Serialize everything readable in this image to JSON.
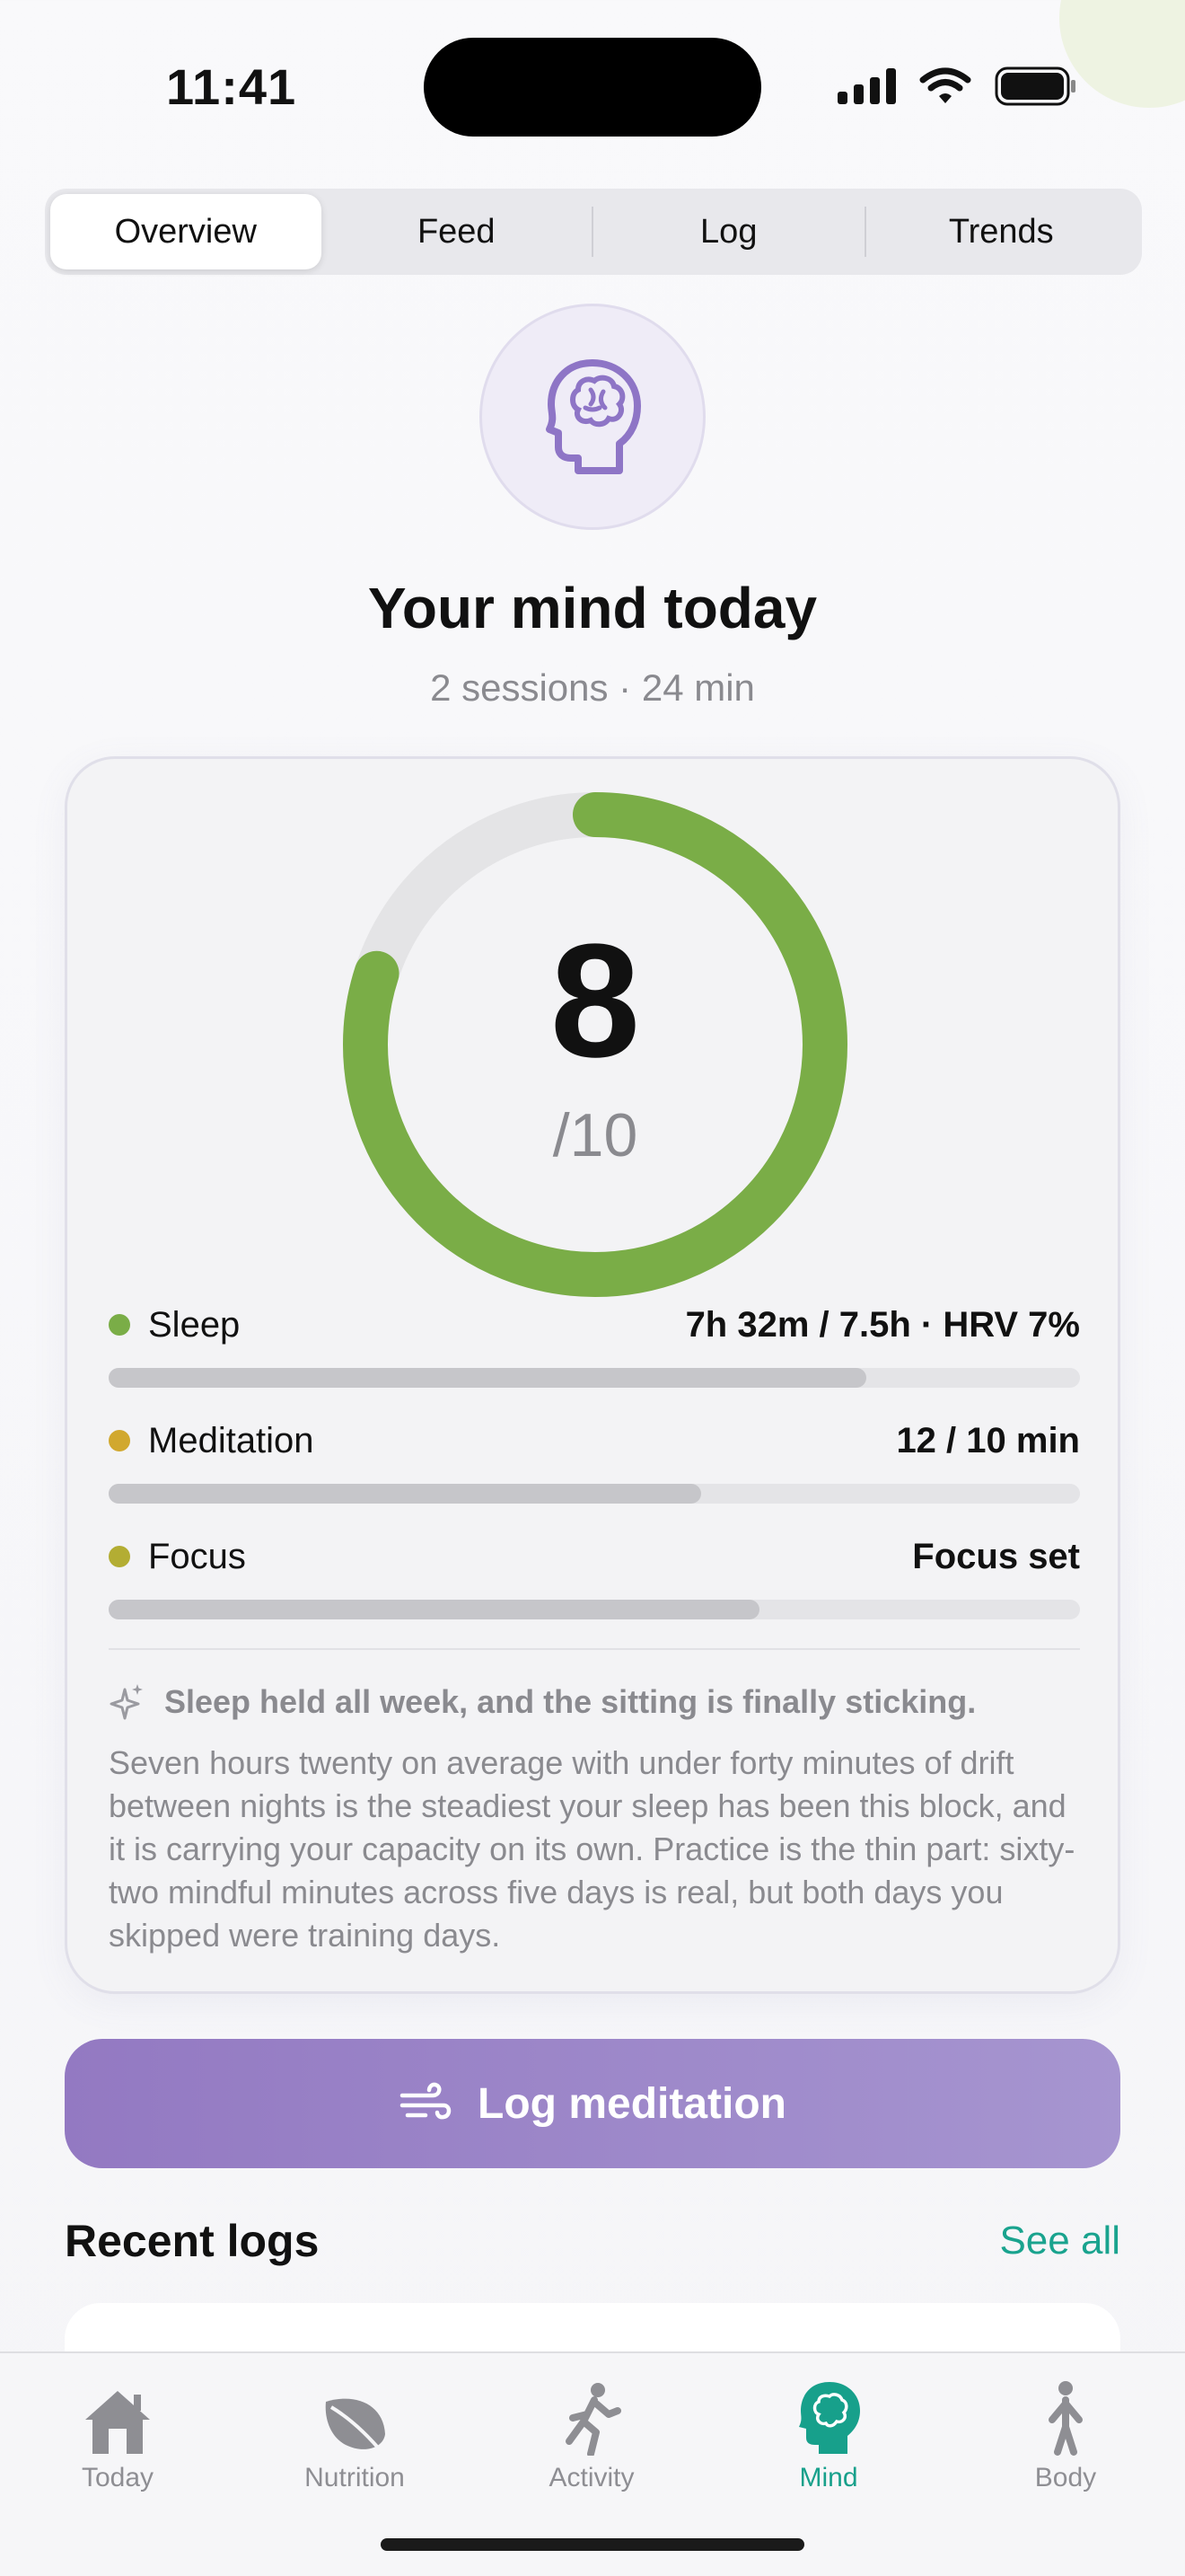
{
  "status_bar": {
    "time": "11:41"
  },
  "segmented": {
    "tabs": [
      {
        "label": "Overview",
        "active": true
      },
      {
        "label": "Feed",
        "active": false
      },
      {
        "label": "Log",
        "active": false
      },
      {
        "label": "Trends",
        "active": false
      }
    ]
  },
  "header": {
    "icon": "brain-head-icon",
    "title": "Your mind today",
    "subtitle": "2 sessions · 24 min"
  },
  "score": {
    "value": "8",
    "denominator": "/10",
    "fraction": 0.8,
    "ring_color": "#7aad47",
    "track_color": "#e4e4e6"
  },
  "metrics": [
    {
      "name": "Sleep",
      "value": "7h 32m / 7.5h · HRV 7%",
      "dot_color": "#7aad47",
      "progress": 0.78
    },
    {
      "name": "Meditation",
      "value": "12 / 10 min",
      "dot_color": "#d1a82e",
      "progress": 0.61
    },
    {
      "name": "Focus",
      "value": "Focus set",
      "dot_color": "#b3ad33",
      "progress": 0.67
    }
  ],
  "insight": {
    "icon": "sparkle-icon",
    "title": "Sleep held all week, and the sitting is finally sticking.",
    "body": "Seven hours twenty on average with under forty minutes of drift between nights is the steadiest your sleep has been this block, and it is carrying your capacity on its own. Practice is the thin part: sixty-two mindful minutes across five days is real, but both days you skipped were training days."
  },
  "cta": {
    "label": "Log meditation",
    "icon": "wind-icon"
  },
  "recent": {
    "title": "Recent logs",
    "see_all": "See all"
  },
  "tabbar": {
    "items": [
      {
        "label": "Today",
        "icon": "house-icon"
      },
      {
        "label": "Nutrition",
        "icon": "leaf-icon"
      },
      {
        "label": "Activity",
        "icon": "running-figure-icon"
      },
      {
        "label": "Mind",
        "icon": "brain-head-icon",
        "active": true
      },
      {
        "label": "Body",
        "icon": "standing-figure-icon"
      }
    ]
  },
  "colors": {
    "accent": "#17a08b",
    "brand_purple": "#9379c2"
  }
}
